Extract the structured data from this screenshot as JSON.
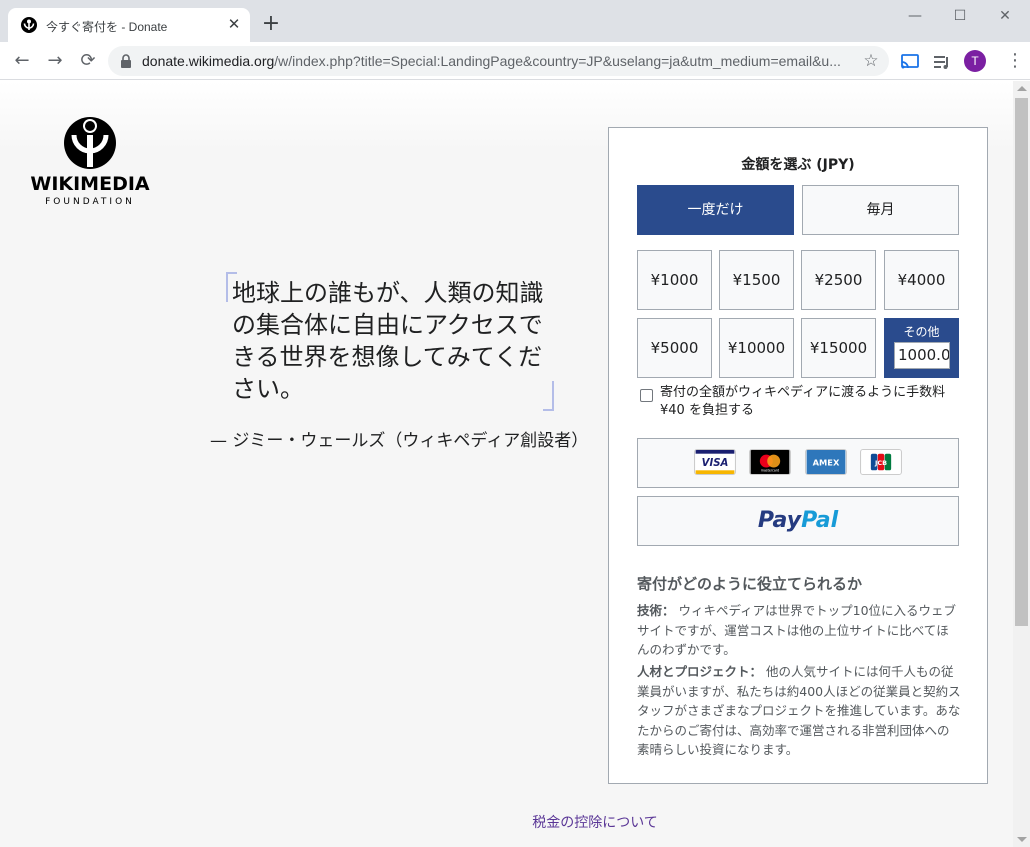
{
  "browser": {
    "tab_title": "今すぐ寄付を - Donate",
    "url_host": "donate.wikimedia.org",
    "url_path": "/w/index.php?title=Special:LandingPage&country=JP&uselang=ja&utm_medium=email&u...",
    "profile_initial": "T"
  },
  "logo": {
    "wordmark": "WIKIMEDIA",
    "subtitle": "FOUNDATION"
  },
  "quote": {
    "text": "地球上の誰もが、人類の知識の集合体に自由にアクセスできる世界を想像してみてください。",
    "author": "— ジミー・ウェールズ（ウィキペディア創設者）"
  },
  "form": {
    "heading": "金額を選ぶ (JPY)",
    "frequency": [
      "一度だけ",
      "毎月"
    ],
    "active_frequency": "一度だけ",
    "amounts": [
      "¥1000",
      "¥1500",
      "¥2500",
      "¥4000",
      "¥5000",
      "¥10000",
      "¥15000"
    ],
    "other_label": "その他",
    "other_value": "1000.0",
    "fee_label": "寄付の全額がウィキペディアに渡るように手数料 ¥40 を負担する",
    "fee_checked": false,
    "cards": [
      "VISA",
      "mastercard",
      "AMEX",
      "JCB"
    ],
    "paypal_part1": "Pay",
    "paypal_part2": "Pal"
  },
  "how": {
    "title": "寄付がどのように役立てられるか",
    "tech_label": "技術：",
    "tech_text": "ウィキペディアは世界でトップ10位に入るウェブサイトですが、運営コストは他の上位サイトに比べてほんのわずかです。",
    "people_label": "人材とプロジェクト：",
    "people_text": "他の人気サイトには何千人もの従業員がいますが、私たちは約400人ほどの従業員と契約スタッフがさまざまなプロジェクトを推進しています。あなたからのご寄付は、高効率で運営される非営利団体への素晴らしい投資になります。"
  },
  "footer": {
    "tax_link": "税金の控除について"
  },
  "colors": {
    "primary": "#2a4b8d",
    "border": "#a2a9b1",
    "link": "#5a3696"
  }
}
